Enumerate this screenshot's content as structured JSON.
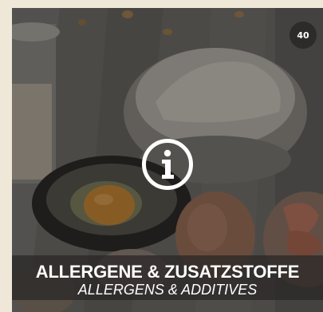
{
  "tile": {
    "badge_count": "40",
    "icon": "info-icon",
    "title": "ALLERGENE & ZUSATZSTOFFE",
    "subtitle": "ALLERGENS & ADDITIVES"
  },
  "colors": {
    "background": "#efe7d8",
    "badge": "#2c2b2a",
    "banner": "#282625",
    "text": "#ffffff"
  }
}
